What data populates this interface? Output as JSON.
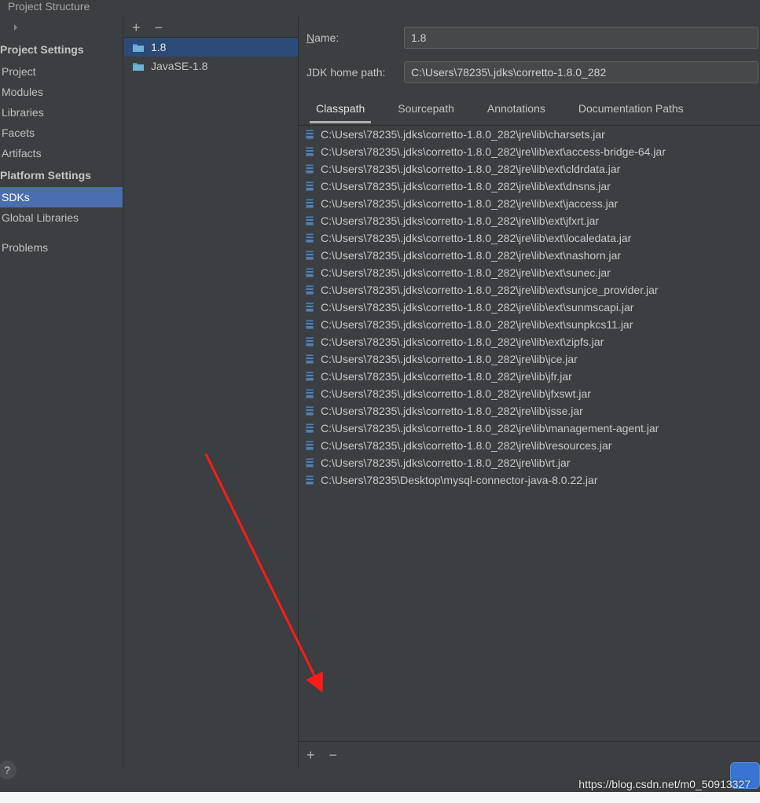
{
  "window": {
    "title": "Project Structure"
  },
  "sidebar": {
    "section1": "Project Settings",
    "section2": "Platform Settings",
    "items1": [
      {
        "label": "Project"
      },
      {
        "label": "Modules"
      },
      {
        "label": "Libraries"
      },
      {
        "label": "Facets"
      },
      {
        "label": "Artifacts"
      }
    ],
    "items2": [
      {
        "label": "SDKs"
      },
      {
        "label": "Global Libraries"
      }
    ],
    "problems": "Problems"
  },
  "sdk_list": [
    {
      "label": "1.8"
    },
    {
      "label": "JavaSE-1.8"
    }
  ],
  "form": {
    "name_label": "Name:",
    "name_value": "1.8",
    "path_label": "JDK home path:",
    "path_value": "C:\\Users\\78235\\.jdks\\corretto-1.8.0_282"
  },
  "tabs": [
    {
      "label": "Classpath"
    },
    {
      "label": "Sourcepath"
    },
    {
      "label": "Annotations"
    },
    {
      "label": "Documentation Paths"
    }
  ],
  "classpath": [
    "C:\\Users\\78235\\.jdks\\corretto-1.8.0_282\\jre\\lib\\charsets.jar",
    "C:\\Users\\78235\\.jdks\\corretto-1.8.0_282\\jre\\lib\\ext\\access-bridge-64.jar",
    "C:\\Users\\78235\\.jdks\\corretto-1.8.0_282\\jre\\lib\\ext\\cldrdata.jar",
    "C:\\Users\\78235\\.jdks\\corretto-1.8.0_282\\jre\\lib\\ext\\dnsns.jar",
    "C:\\Users\\78235\\.jdks\\corretto-1.8.0_282\\jre\\lib\\ext\\jaccess.jar",
    "C:\\Users\\78235\\.jdks\\corretto-1.8.0_282\\jre\\lib\\ext\\jfxrt.jar",
    "C:\\Users\\78235\\.jdks\\corretto-1.8.0_282\\jre\\lib\\ext\\localedata.jar",
    "C:\\Users\\78235\\.jdks\\corretto-1.8.0_282\\jre\\lib\\ext\\nashorn.jar",
    "C:\\Users\\78235\\.jdks\\corretto-1.8.0_282\\jre\\lib\\ext\\sunec.jar",
    "C:\\Users\\78235\\.jdks\\corretto-1.8.0_282\\jre\\lib\\ext\\sunjce_provider.jar",
    "C:\\Users\\78235\\.jdks\\corretto-1.8.0_282\\jre\\lib\\ext\\sunmscapi.jar",
    "C:\\Users\\78235\\.jdks\\corretto-1.8.0_282\\jre\\lib\\ext\\sunpkcs11.jar",
    "C:\\Users\\78235\\.jdks\\corretto-1.8.0_282\\jre\\lib\\ext\\zipfs.jar",
    "C:\\Users\\78235\\.jdks\\corretto-1.8.0_282\\jre\\lib\\jce.jar",
    "C:\\Users\\78235\\.jdks\\corretto-1.8.0_282\\jre\\lib\\jfr.jar",
    "C:\\Users\\78235\\.jdks\\corretto-1.8.0_282\\jre\\lib\\jfxswt.jar",
    "C:\\Users\\78235\\.jdks\\corretto-1.8.0_282\\jre\\lib\\jsse.jar",
    "C:\\Users\\78235\\.jdks\\corretto-1.8.0_282\\jre\\lib\\management-agent.jar",
    "C:\\Users\\78235\\.jdks\\corretto-1.8.0_282\\jre\\lib\\resources.jar",
    "C:\\Users\\78235\\.jdks\\corretto-1.8.0_282\\jre\\lib\\rt.jar",
    "C:\\Users\\78235\\Desktop\\mysql-connector-java-8.0.22.jar"
  ],
  "watermark": "https://blog.csdn.net/m0_50913327"
}
